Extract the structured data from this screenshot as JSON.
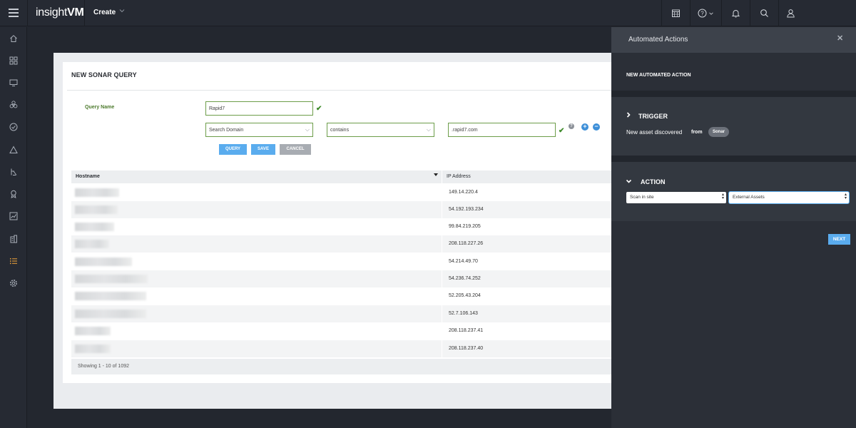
{
  "app": {
    "logo_prefix": "insight",
    "logo_suffix": "VM",
    "create_label": "Create"
  },
  "icons": {
    "topbar": [
      "calendar-icon",
      "help-icon",
      "bell-icon",
      "search-icon",
      "user-icon"
    ],
    "nav": [
      "home-icon",
      "dashboard-icon",
      "monitor-icon",
      "biohazard-icon",
      "check-circle-icon",
      "warning-icon",
      "policy-icon",
      "award-icon",
      "chart-icon",
      "building-icon",
      "list-icon",
      "gear-icon"
    ],
    "active_nav": "list-icon"
  },
  "query": {
    "title": "NEW SONAR QUERY",
    "name_label": "Query Name",
    "name_value": "Rapid7",
    "filter_field": "Search Domain",
    "filter_operator": "contains",
    "filter_value": ".rapid7.com",
    "buttons": {
      "query": "QUERY",
      "save": "SAVE",
      "cancel": "CANCEL"
    }
  },
  "table": {
    "columns": [
      "Hostname",
      "IP Address"
    ],
    "rows": [
      {
        "ip": "149.14.220.4"
      },
      {
        "ip": "54.192.193.234"
      },
      {
        "ip": "99.84.219.205"
      },
      {
        "ip": "208.118.227.26"
      },
      {
        "ip": "54.214.49.70"
      },
      {
        "ip": "54.236.74.252"
      },
      {
        "ip": "52.205.43.204"
      },
      {
        "ip": "52.7.106.143"
      },
      {
        "ip": "208.118.237.41"
      },
      {
        "ip": "208.118.237.40"
      }
    ],
    "footer": "Showing 1 - 10 of 1092"
  },
  "automated_actions": {
    "title": "Automated Actions",
    "close": "✕",
    "subtitle": "NEW AUTOMATED ACTION",
    "trigger": {
      "label": "TRIGGER",
      "text": "New asset discovered",
      "from": "from",
      "source": "Sonar"
    },
    "action": {
      "label": "ACTION",
      "select_action": "Scan in site",
      "select_site": "External Assets"
    },
    "next": "NEXT"
  },
  "colors": {
    "accent": "#5aacee",
    "valid_border": "#6d9d4a",
    "active_nav": "#f0a43a"
  }
}
